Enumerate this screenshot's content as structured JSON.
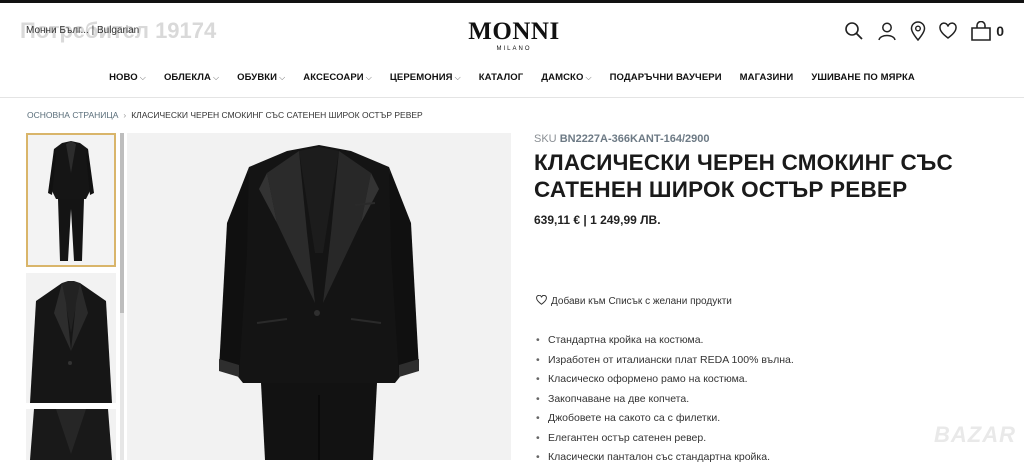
{
  "watermark": "Потребител 19174",
  "header": {
    "language": "Монни Бълг... | Bulgarian",
    "brand": "MONNI",
    "brand_sub": "MILANO",
    "cart_count": "0",
    "icons": [
      "search-icon",
      "user-icon",
      "location-icon",
      "heart-icon",
      "cart-icon"
    ]
  },
  "nav": {
    "items": [
      {
        "label": "НОВО",
        "dropdown": true
      },
      {
        "label": "ОБЛЕКЛА",
        "dropdown": true
      },
      {
        "label": "ОБУВКИ",
        "dropdown": true
      },
      {
        "label": "АКСЕСОАРИ",
        "dropdown": true
      },
      {
        "label": "ЦЕРЕМОНИЯ",
        "dropdown": true
      },
      {
        "label": "КАТАЛОГ",
        "dropdown": false
      },
      {
        "label": "ДАМСКО",
        "dropdown": true
      },
      {
        "label": "ПОДАРЪЧНИ ВАУЧЕРИ",
        "dropdown": false
      },
      {
        "label": "МАГАЗИНИ",
        "dropdown": false
      },
      {
        "label": "УШИВАНЕ ПО МЯРКА",
        "dropdown": false
      }
    ],
    "chevron": "⌵"
  },
  "breadcrumb": {
    "home": "ОСНОВНА СТРАНИЦА",
    "separator": "›",
    "current": "КЛАСИЧЕСКИ ЧЕРЕН СМОКИНГ СЪС САТЕНЕН ШИРОК ОСТЪР РЕВЕР"
  },
  "product": {
    "sku_label": "SKU",
    "sku": "BN2227A-366KANT-164/2900",
    "title": "КЛАСИЧЕСКИ ЧЕРЕН СМОКИНГ СЪС САТЕНЕН ШИРОК ОСТЪР РЕВЕР",
    "price": "639,11 € | 1 249,99 ЛВ.",
    "wishlist": "Добави към Списък с желани продукти",
    "features": [
      "Стандартна кройка на костюма.",
      "Изработен от италиански плат REDA 100% вълна.",
      "Класическо оформено рамо на костюма.",
      "Закопчаване на две копчета.",
      "Джобовете на сакото са с филетки.",
      "Елегантен остър сатенен ревер.",
      "Класически панталон със стандартна кройка."
    ]
  },
  "bazar_logo": "BAZAR",
  "colors": {
    "accent_thumb_border": "#d9b56a",
    "text_dark": "#1a1a1a",
    "sku_color": "#6d7a85"
  }
}
